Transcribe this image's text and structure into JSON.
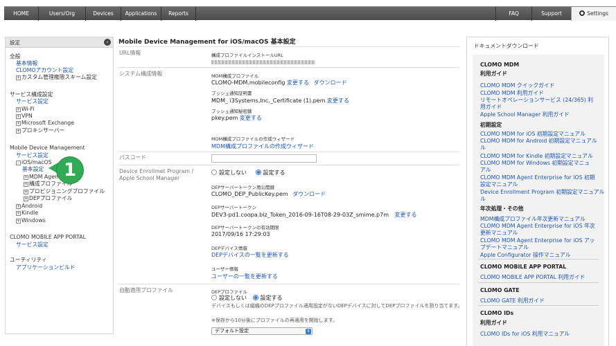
{
  "nav": {
    "left": [
      "HOME",
      "Users/Org",
      "Devices",
      "Applications",
      "Reports"
    ],
    "right": [
      "FAQ",
      "Support"
    ],
    "settings": "Settings"
  },
  "sidebar": {
    "header": "設定",
    "lines": [
      {
        "text": "全般",
        "kind": "h",
        "indent": 0
      },
      {
        "text": "基本情報",
        "kind": "l",
        "indent": 9
      },
      {
        "text": "CLOMOアカウント設定",
        "kind": "l",
        "indent": 9
      },
      {
        "text": "カスタム管理権限スキーム設定",
        "kind": "t",
        "indent": 9,
        "toggle": "+"
      },
      {
        "text": "サービス構成設定",
        "kind": "h",
        "indent": 0
      },
      {
        "text": "サービス設定",
        "kind": "l",
        "indent": 9
      },
      {
        "text": "Wi-Fi",
        "kind": "t",
        "indent": 9,
        "toggle": "+"
      },
      {
        "text": "VPN",
        "kind": "t",
        "indent": 9,
        "toggle": "+"
      },
      {
        "text": "Microsoft Exchange",
        "kind": "t",
        "indent": 9,
        "toggle": "+"
      },
      {
        "text": "プロキシサーバー",
        "kind": "t",
        "indent": 9,
        "toggle": "+"
      },
      {
        "text": "Mobile Device Management",
        "kind": "h",
        "indent": 0
      },
      {
        "text": "サービス設定",
        "kind": "l",
        "indent": 9
      },
      {
        "text": "iOS/macOS",
        "kind": "t",
        "indent": 9,
        "toggle": "-"
      },
      {
        "text": "基本設定",
        "kind": "l",
        "indent": 18
      },
      {
        "text": "MDM Agent",
        "kind": "t",
        "indent": 20,
        "toggle": "+"
      },
      {
        "text": "構成プロファイル",
        "kind": "t",
        "indent": 20,
        "toggle": "+"
      },
      {
        "text": "プロビジョニングプロファイル",
        "kind": "t",
        "indent": 20,
        "toggle": "+"
      },
      {
        "text": "DEPプロファイル",
        "kind": "t",
        "indent": 20,
        "toggle": "+"
      },
      {
        "text": "Android",
        "kind": "t",
        "indent": 9,
        "toggle": "+"
      },
      {
        "text": "Kindle",
        "kind": "t",
        "indent": 9,
        "toggle": "+"
      },
      {
        "text": "Windows",
        "kind": "t",
        "indent": 9,
        "toggle": "+"
      },
      {
        "text": "CLOMO MOBILE APP PORTAL",
        "kind": "h",
        "indent": 0
      },
      {
        "text": "サービス設定",
        "kind": "l",
        "indent": 9
      },
      {
        "text": "ユーティリティ",
        "kind": "h",
        "indent": 0
      },
      {
        "text": "アプリケーションビルド",
        "kind": "l",
        "indent": 9
      }
    ],
    "badge": "1"
  },
  "main": {
    "title": "Mobile Device Management for iOS/macOS 基本設定",
    "url_info": {
      "label": "URL情報",
      "caption": "構成プロファイルインストールURL"
    },
    "system": {
      "label": "システム構成情報",
      "mdm_profile_caption": "MDM構成プロファイル",
      "mdm_profile_value": "CLOMO-MDM.mobileconfig",
      "change": "変更する",
      "download": "ダウンロード",
      "push_cert_caption": "プッシュ通知証明書",
      "push_cert_value": "MDM_ i3Systems,Inc._Certificate (1).pem",
      "push_key_caption": "プッシュ通知秘密鍵",
      "push_key_value": "pkey.pem",
      "wizard_caption": "MDM構成プロファイルの作成ウィザード",
      "wizard_link": "MDM構成プロファイルの作成ウィザード"
    },
    "passcode": {
      "label": "パスコード"
    },
    "dep": {
      "label": "Device Enrollmet Program / Apple School Manager",
      "radio_off": "設定しない",
      "radio_on": "設定する",
      "pubkey_caption": "DEPサーバートークン用公開鍵",
      "pubkey_value": "CLOMO_DEP_PublicKey.pem",
      "download": "ダウンロード",
      "token_caption": "DEPサーバートークン",
      "token_value": "DEV3-pd1.coopa.biz_Token_2016-09-16T08-29-03Z_smime.p7m",
      "change": "変更する",
      "expiry_caption": "DEPサーバートークンの有効期限",
      "expiry_value": "2017/09/16 17:29:03",
      "devinfo_caption": "DEPデバイス情報",
      "devinfo_link": "DEPデバイスの一覧を更新する",
      "userinfo_caption": "ユーザー情報",
      "userinfo_link": "ユーザーの一覧を更新する"
    },
    "auto_profile": {
      "label": "自動適用プロファイル",
      "caption": "DEPプロファイル",
      "radio_off": "設定しない",
      "radio_on": "設定する",
      "desc": "デバイスもしくは組織のDEPプロファイル適用設定がないDEPデバイスに対してDEPプロファイルを割り当てます。",
      "note": "※保存から10分後にプロファイルの再適用を開始します。",
      "select_value": "デフォルト設定"
    }
  },
  "docs": {
    "title": "ドキュメントダウンロード",
    "lines": [
      {
        "text": "CLOMO MDM",
        "kind": "h"
      },
      {
        "text": "利用ガイド",
        "kind": "h"
      },
      {
        "text": "CLOMO MDM クイックガイド",
        "kind": "l"
      },
      {
        "text": "CLOMO MDM 利用ガイド",
        "kind": "l"
      },
      {
        "text": "リモートオペレーションサービス (24/365) 利",
        "kind": "l"
      },
      {
        "text": "用ガイド",
        "kind": "l"
      },
      {
        "text": "Apple School Manager 利用ガイド",
        "kind": "l"
      },
      {
        "text": "初期設定",
        "kind": "h"
      },
      {
        "text": "CLOMO MDM for iOS 初期設定マニュアル",
        "kind": "l"
      },
      {
        "text": "CLOMO MDM for Android 初期設定マニュアル",
        "kind": "l"
      },
      {
        "text": "ル",
        "kind": "l"
      },
      {
        "text": "CLOMO MDM for Kindle 初期設定マニュアル",
        "kind": "l"
      },
      {
        "text": "CLOMO MDM for Windows 初期設定マニュ",
        "kind": "l"
      },
      {
        "text": "アル",
        "kind": "l"
      },
      {
        "text": "CLOMO MDM Agent Enterprise for iOS 初期",
        "kind": "l"
      },
      {
        "text": "設定マニュアル",
        "kind": "l"
      },
      {
        "text": "Device Enrollment Program 初期設定マニュアル",
        "kind": "l"
      },
      {
        "text": "ル",
        "kind": "l"
      },
      {
        "text": "年次処理・その他",
        "kind": "h"
      },
      {
        "text": "MDM構成プロファイル年次更新マニュアル",
        "kind": "l"
      },
      {
        "text": "CLOMO MDM Agent Enterprise for iOS 年次",
        "kind": "l"
      },
      {
        "text": "更新マニュアル",
        "kind": "l"
      },
      {
        "text": "CLOMO MDM Agent Enterprise for iOS アッ",
        "kind": "l"
      },
      {
        "text": "プデートマニュアル",
        "kind": "l"
      },
      {
        "text": "Apple Configurator 操作マニュアル",
        "kind": "l"
      },
      {
        "text": "CLOMO MOBILE APP PORTAL",
        "kind": "h"
      },
      {
        "text": "CLOMO MOBILE APP PORTAL 利用ガイド",
        "kind": "l"
      },
      {
        "text": "CLOMO GATE",
        "kind": "h"
      },
      {
        "text": "CLOMO GATE 利用ガイド",
        "kind": "l"
      },
      {
        "text": "CLOMO IDs",
        "kind": "h"
      },
      {
        "text": "利用ガイド",
        "kind": "h"
      },
      {
        "text": "CLOMO IDs for iOS 利用マニュアル",
        "kind": "l"
      }
    ]
  }
}
